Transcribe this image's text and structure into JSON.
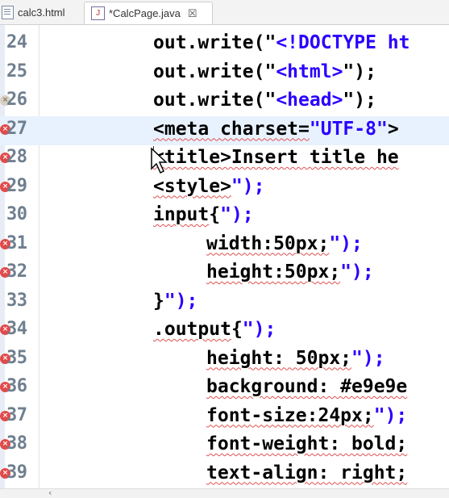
{
  "tabs": [
    {
      "label": "calc3.html"
    },
    {
      "label": "*CalcPage.java",
      "close": "☒"
    }
  ],
  "lines": [
    {
      "num": "24",
      "marker": "",
      "indent": 190,
      "parts": [
        [
          "t",
          "out.write(\""
        ],
        [
          "s",
          "<!DOCTYPE ht"
        ]
      ]
    },
    {
      "num": "25",
      "marker": "",
      "indent": 190,
      "parts": [
        [
          "t",
          "out.write(\""
        ],
        [
          "s",
          "<html>"
        ],
        [
          "t",
          "\");"
        ]
      ]
    },
    {
      "num": "26",
      "marker": "warn",
      "indent": 190,
      "parts": [
        [
          "t",
          "out.write(\""
        ],
        [
          "s",
          "<head>"
        ],
        [
          "t",
          "\");"
        ]
      ]
    },
    {
      "num": "27",
      "marker": "error",
      "indent": 190,
      "current": true,
      "parts": [
        [
          "sq",
          "<meta charset="
        ],
        [
          "s",
          "\"UTF-8\""
        ],
        [
          "t",
          ">"
        ]
      ]
    },
    {
      "num": "28",
      "marker": "error",
      "indent": 190,
      "parts": [
        [
          "sq",
          "<title>Insert title he"
        ]
      ]
    },
    {
      "num": "29",
      "marker": "error",
      "indent": 190,
      "parts": [
        [
          "sq",
          "<style>"
        ],
        [
          "s",
          "\");"
        ]
      ]
    },
    {
      "num": "30",
      "marker": "",
      "indent": 190,
      "parts": [
        [
          "sq",
          "input"
        ],
        [
          "t",
          "{"
        ],
        [
          "s",
          "\");"
        ]
      ]
    },
    {
      "num": "31",
      "marker": "error",
      "indent": 256,
      "parts": [
        [
          "sq",
          "width:50px;"
        ],
        [
          "s",
          "\");"
        ]
      ]
    },
    {
      "num": "32",
      "marker": "error",
      "indent": 256,
      "parts": [
        [
          "sq",
          "height:50px;"
        ],
        [
          "s",
          "\");"
        ]
      ]
    },
    {
      "num": "33",
      "marker": "",
      "indent": 190,
      "parts": [
        [
          "t",
          "}"
        ],
        [
          "s",
          "\");"
        ]
      ]
    },
    {
      "num": "34",
      "marker": "error",
      "indent": 190,
      "parts": [
        [
          "sq",
          ".output"
        ],
        [
          "t",
          "{"
        ],
        [
          "s",
          "\");"
        ]
      ]
    },
    {
      "num": "35",
      "marker": "error",
      "indent": 256,
      "parts": [
        [
          "sq",
          "height: 50px;"
        ],
        [
          "s",
          "\");"
        ]
      ]
    },
    {
      "num": "36",
      "marker": "error",
      "indent": 256,
      "parts": [
        [
          "sq",
          "background: #e9e9e"
        ]
      ]
    },
    {
      "num": "37",
      "marker": "error",
      "indent": 256,
      "parts": [
        [
          "sq",
          "font-size:24px;"
        ],
        [
          "s",
          "\");"
        ]
      ]
    },
    {
      "num": "38",
      "marker": "error",
      "indent": 256,
      "parts": [
        [
          "sq",
          "font-weight: bold;"
        ]
      ]
    },
    {
      "num": "39",
      "marker": "error",
      "indent": 256,
      "parts": [
        [
          "sq",
          "text-align: right;"
        ]
      ]
    }
  ],
  "colors": {
    "string": "#2a00ff",
    "keyword": "#000000",
    "error": "#e04a4a",
    "current_line": "#e8f2fe"
  },
  "scroll": {
    "left_arrow": "‹"
  }
}
